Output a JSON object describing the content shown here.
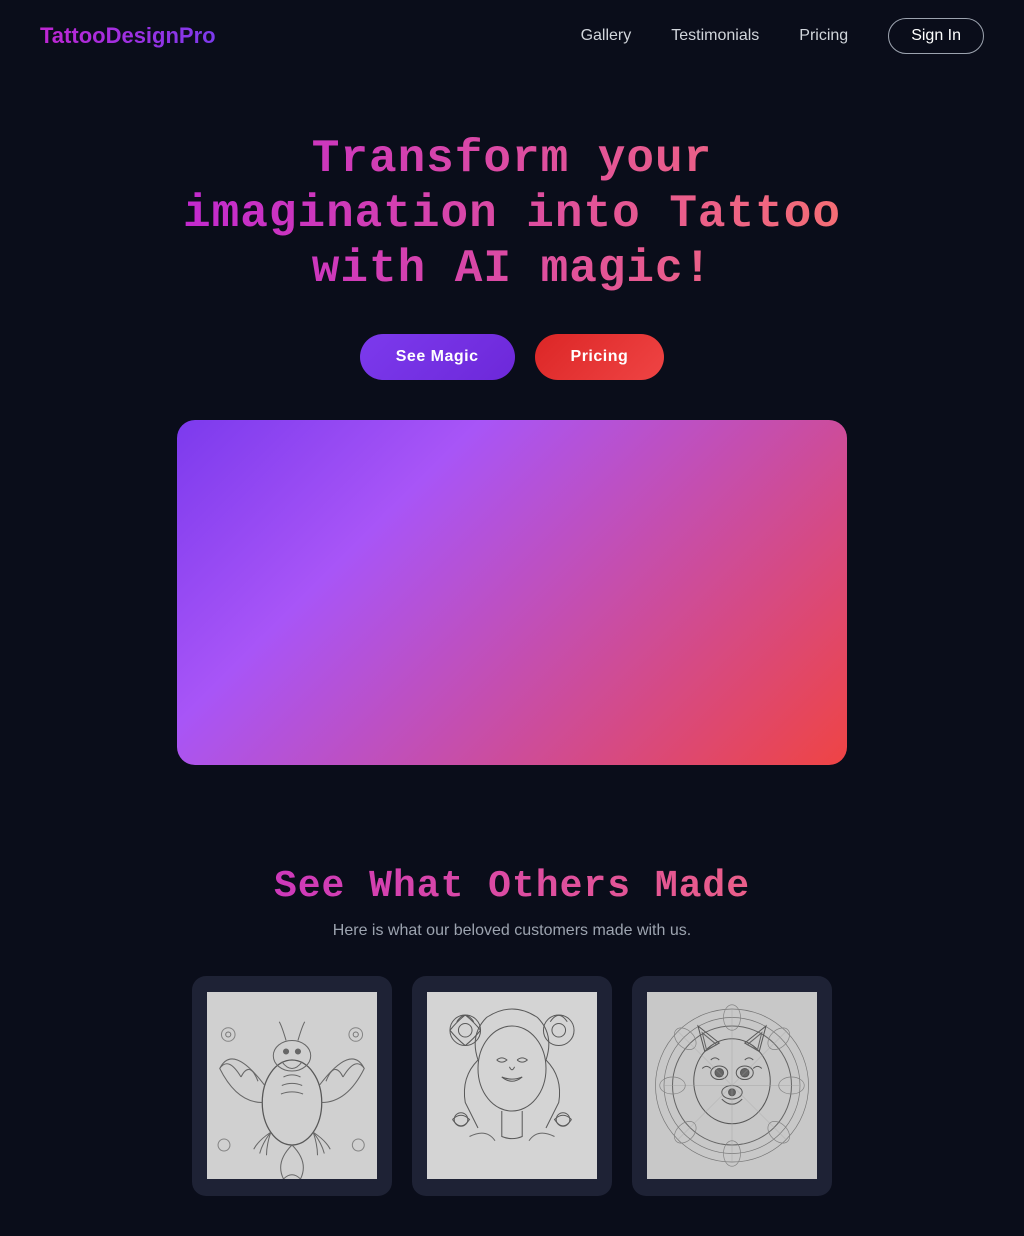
{
  "navbar": {
    "logo": "TattooDesignPro",
    "links": [
      {
        "id": "gallery",
        "label": "Gallery"
      },
      {
        "id": "testimonials",
        "label": "Testimonials"
      },
      {
        "id": "pricing",
        "label": "Pricing"
      }
    ],
    "signin_label": "Sign In"
  },
  "hero": {
    "title": "Transform your imagination into Tattoo with AI magic!",
    "buttons": {
      "see_magic": "See Magic",
      "pricing": "Pricing"
    }
  },
  "gallery": {
    "title": "See What Others Made",
    "subtitle": "Here is what our beloved customers made with us.",
    "items": [
      {
        "id": "dragon",
        "alt": "Dragon tattoo design"
      },
      {
        "id": "woman",
        "alt": "Woman with flowers tattoo design"
      },
      {
        "id": "wolf",
        "alt": "Wolf mandala tattoo design"
      }
    ]
  }
}
